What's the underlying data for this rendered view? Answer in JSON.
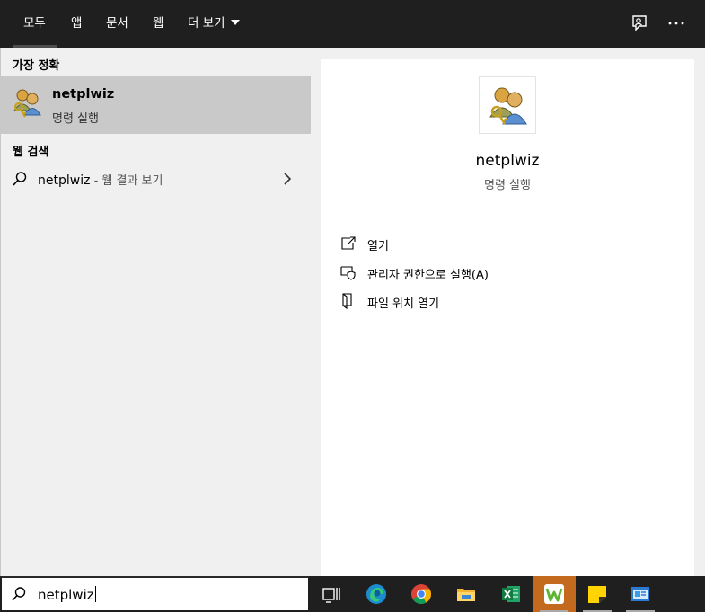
{
  "tabs": [
    {
      "label": "모두",
      "active": true
    },
    {
      "label": "앱"
    },
    {
      "label": "문서"
    },
    {
      "label": "웹"
    },
    {
      "label": "더 보기"
    }
  ],
  "top_icons": [
    "feedback-icon",
    "more-icon"
  ],
  "left": {
    "best_match_header": "가장 정확",
    "best_match": {
      "title": "netplwiz",
      "subtitle": "명령 실행",
      "icon": "users-key-icon"
    },
    "web_header": "웹 검색",
    "web_result": {
      "query": "netplwiz",
      "hint": " - 웹 결과 보기"
    }
  },
  "right": {
    "title": "netplwiz",
    "subtitle": "명령 실행",
    "actions": [
      {
        "label": "열기",
        "icon": "open-icon"
      },
      {
        "label": "관리자 권한으로 실행(A)",
        "icon": "shield-icon"
      },
      {
        "label": "파일 위치 열기",
        "icon": "file-location-icon"
      }
    ]
  },
  "search": {
    "value": "netplwiz"
  },
  "taskbar": {
    "items": [
      "task-view-icon",
      "edge-icon",
      "chrome-icon",
      "file-explorer-icon",
      "excel-icon",
      "w-app-icon",
      "sticky-notes-icon",
      "control-panel-icon"
    ]
  },
  "colors": {
    "topbar": "#1f1f1f",
    "selected": "#c9c9c9",
    "panel": "#f0f0f0",
    "taskbar_active": "#c46a1f"
  }
}
